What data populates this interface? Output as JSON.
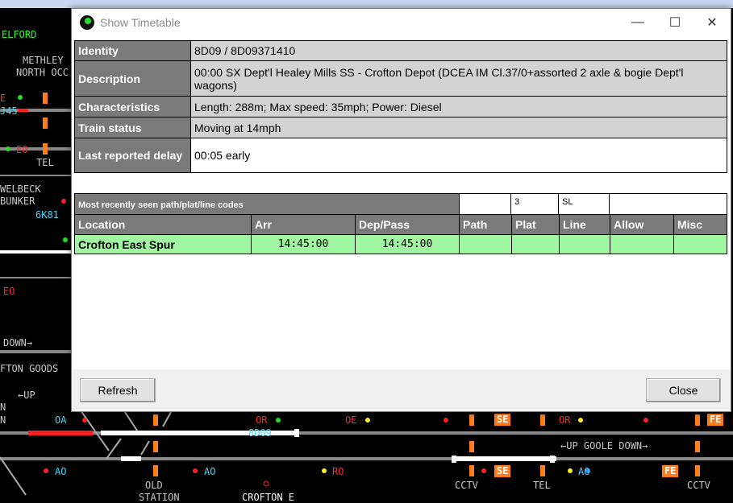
{
  "window": {
    "title": "Show Timetable",
    "minimize": "—",
    "maximize": "☐",
    "close": "✕"
  },
  "info": {
    "identity_label": "Identity",
    "identity_value": "8D09 / 8D09371410",
    "description_label": "Description",
    "description_value": "00:00 SX Dept'l Healey Mills SS - Crofton Depot (DCEA IM Cl.37/0+assorted 2 axle & bogie Dept'l wagons)",
    "characteristics_label": "Characteristics",
    "characteristics_value": "Length: 288m; Max speed: 35mph; Power: Diesel",
    "status_label": "Train status",
    "status_value": "Moving at 14mph",
    "delay_label": "Last reported delay",
    "delay_value": "00:05 early"
  },
  "codes": {
    "label": "Most recently seen path/plat/line codes",
    "path": "",
    "plat": "3",
    "line": "SL",
    "misc": ""
  },
  "timetable": {
    "headers": [
      "Location",
      "Arr",
      "Dep/Pass",
      "Path",
      "Plat",
      "Line",
      "Allow",
      "Misc"
    ],
    "rows": [
      {
        "location": "Crofton East Spur",
        "arr": "14:45:00",
        "dep": "14:45:00",
        "path": "",
        "plat": "",
        "line": "",
        "allow": "",
        "misc": ""
      }
    ]
  },
  "buttons": {
    "refresh": "Refresh",
    "close": "Close"
  },
  "background": {
    "labels": {
      "elford": "ELFORD",
      "methley": "METHLEY",
      "north_oc": "NORTH OCC",
      "j45": "J45",
      "tel1": "TEL",
      "welbeck": "WELBECK",
      "bunker": "BUNKER",
      "gk81": "6K81",
      "down": "DOWN→",
      "fton_goods": "FTON GOODS",
      "up": "←UP",
      "n1": "N",
      "n2": "N",
      "oa1": "OA",
      "or1": "OR",
      "oe1": "OE",
      "or2": "OR",
      "train_8d09": "8D09",
      "se1": "SE",
      "se2": "SE",
      "fe1": "FE",
      "fe2": "FE",
      "up_goole_down": "←UP GOOLE DOWN→",
      "ao1": "AO",
      "ao2": "AO",
      "ro": "RO",
      "ao3": "AO",
      "old": "OLD",
      "station": "STATION",
      "crofton_e": "CROFTON E",
      "cctv1": "CCTV",
      "tel2": "TEL",
      "cctv2": "CCTV",
      "eo1": "EO",
      "eo2": "EO",
      "e_top": "E"
    }
  }
}
